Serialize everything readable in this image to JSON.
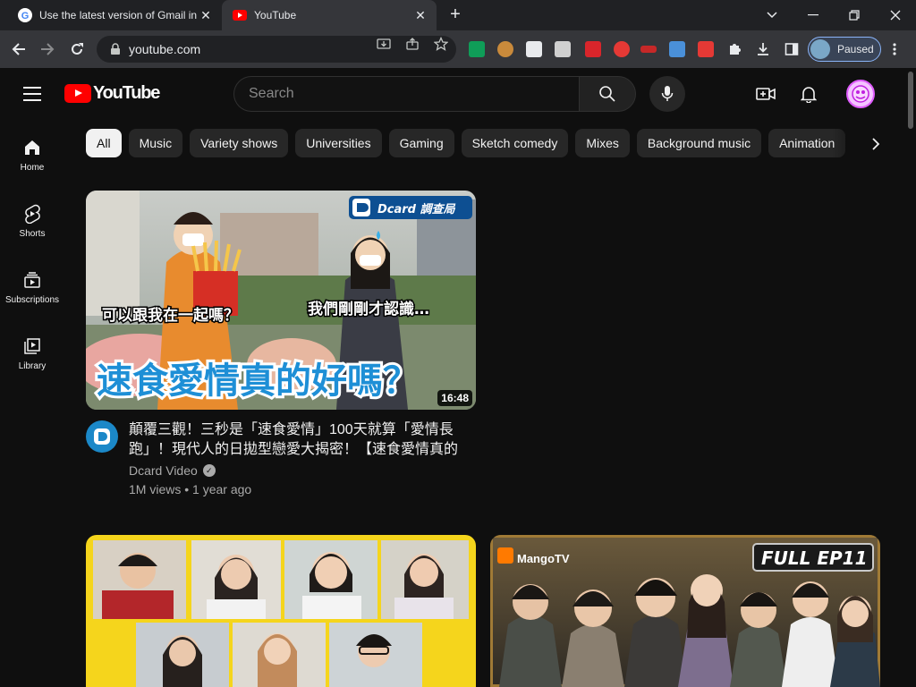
{
  "browser": {
    "tabs": [
      {
        "title": "Use the latest version of Gmail in",
        "favicon": "google-icon"
      },
      {
        "title": "YouTube",
        "favicon": "youtube-icon"
      }
    ],
    "url": "youtube.com",
    "profile_label": "Paused"
  },
  "youtube": {
    "logo_text": "YouTube",
    "search_placeholder": "Search",
    "guide": [
      {
        "label": "Home",
        "icon": "home-icon"
      },
      {
        "label": "Shorts",
        "icon": "shorts-icon"
      },
      {
        "label": "Subscriptions",
        "icon": "subscriptions-icon"
      },
      {
        "label": "Library",
        "icon": "library-icon"
      }
    ],
    "chips": [
      "All",
      "Music",
      "Variety shows",
      "Universities",
      "Gaming",
      "Sketch comedy",
      "Mixes",
      "Background music",
      "Animation"
    ],
    "videos": [
      {
        "title": "顛覆三觀！三秒是「速食愛情」100天就算「愛情長跑」！現代人的日拋型戀愛大揭密！【速食愛情真的好嗎？】",
        "channel": "Dcard Video",
        "meta": "1M views • 1 year ago",
        "duration": "16:48",
        "thumb_badge": "Dcard 調查局",
        "thumb_caption_1": "可以跟我在一起嗎？",
        "thumb_caption_2": "我們剛剛才認識…",
        "thumb_headline": "速食愛情真的好嗎？"
      },
      {
        "thumb_badge": "",
        "duration": ""
      },
      {
        "thumb_brand": "MangoTV",
        "thumb_badge": "FULL EP11"
      }
    ]
  },
  "colors": {
    "bg": "#0f0f0f",
    "brand_red": "#ff0000",
    "chip_bg": "#272727",
    "chip_active_bg": "#f1f1f1",
    "text_secondary": "#aaaaaa",
    "browser_tabstrip": "#202124",
    "browser_toolbar": "#35363a"
  }
}
